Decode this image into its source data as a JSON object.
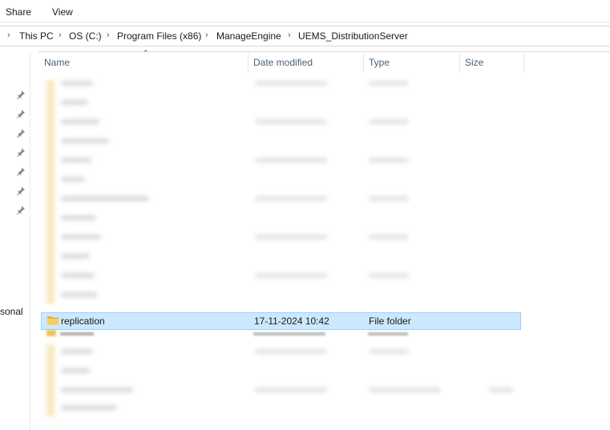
{
  "ribbon": {
    "tabs": [
      "Share",
      "View"
    ]
  },
  "breadcrumb": [
    "This PC",
    "OS (C:)",
    "Program Files (x86)",
    "ManageEngine",
    "UEMS_DistributionServer"
  ],
  "nav": {
    "partial_label": "sonal"
  },
  "columns": {
    "name": "Name",
    "date": "Date modified",
    "type": "Type",
    "size": "Size"
  },
  "selected_row": {
    "name": "replication",
    "date": "17-11-2024 10:42",
    "type": "File folder"
  },
  "colors": {
    "selection_bg": "#cce8ff",
    "selection_border": "#99d1ff",
    "folder": "#e8b43c",
    "header_text": "#4c607a"
  },
  "icons": {
    "pin": "pin-icon",
    "folder": "folder-icon",
    "sort": "sort-ascending-icon",
    "chevron": "chevron-right-icon"
  }
}
